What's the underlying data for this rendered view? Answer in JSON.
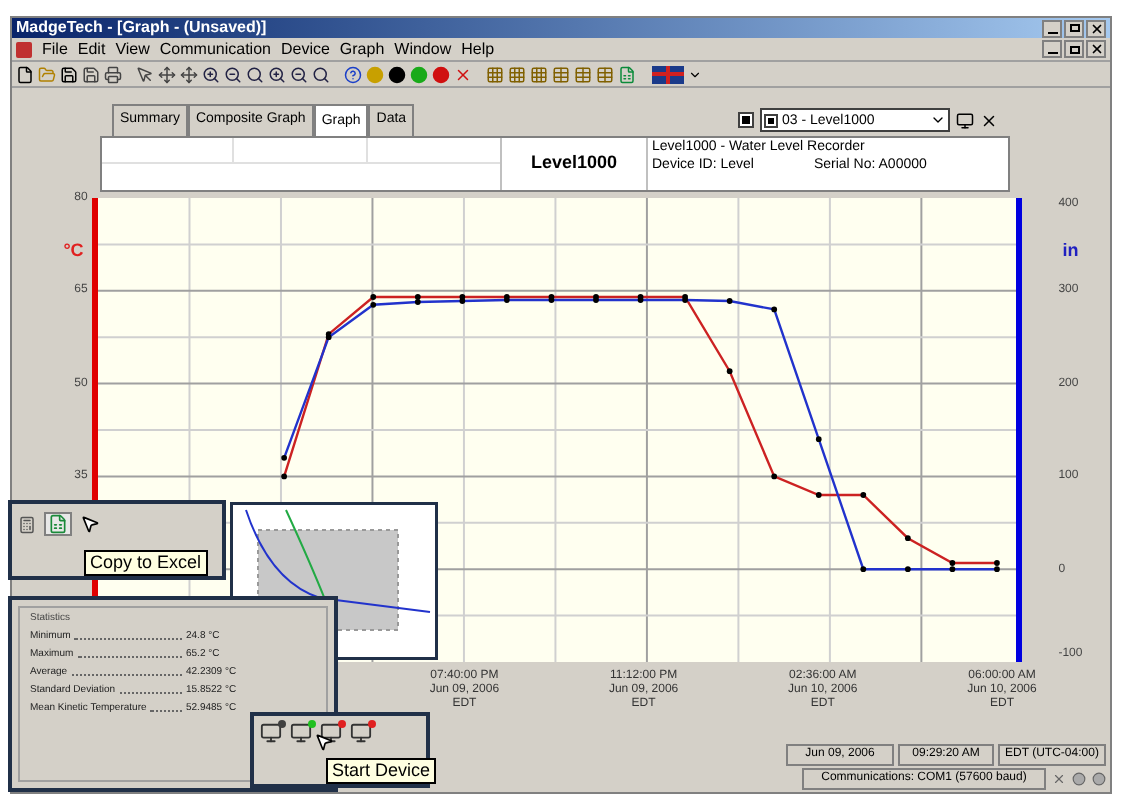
{
  "window": {
    "title": "MadgeTech - [Graph - (Unsaved)]"
  },
  "menu": [
    "File",
    "Edit",
    "View",
    "Communication",
    "Device",
    "Graph",
    "Window",
    "Help"
  ],
  "tabs": [
    {
      "label": "Summary",
      "selected": false
    },
    {
      "label": "Composite Graph",
      "selected": false
    },
    {
      "label": "Graph",
      "selected": true
    },
    {
      "label": "Data",
      "selected": false
    }
  ],
  "device_picker": {
    "show_checked": true,
    "checked": true,
    "value": "03 - Level1000"
  },
  "header": {
    "title": "Level1000",
    "lines": [
      "Level1000 - Water Level Recorder",
      "Device ID: Level",
      "Serial No: A00000"
    ]
  },
  "chart": {
    "chart_data": {
      "type": "line",
      "ylabel": "°C",
      "ylim": [
        5,
        80
      ],
      "yticks": [
        80,
        65,
        50,
        35
      ],
      "y2label": "in",
      "y2lim": [
        -100,
        400
      ],
      "y2ticks": [
        400,
        300,
        200,
        100,
        0,
        -100
      ],
      "grid": true,
      "categories": [
        null,
        null,
        null,
        null,
        null,
        null,
        null,
        null,
        "07:40:00 PM\nJun 09, 2006\nEDT",
        null,
        null,
        null,
        "11:12:00 PM\nJun 09, 2006\nEDT",
        null,
        null,
        null,
        "02:36:00 AM\nJun 10, 2006\nEDT",
        null,
        null,
        null,
        "06:00:00 AM\nJun 10, 2006\nEDT"
      ],
      "series": [
        {
          "color": "#cc2222",
          "values": [
            null,
            null,
            null,
            null,
            35,
            58,
            64,
            64,
            64,
            64,
            64,
            64,
            64,
            64,
            52,
            35,
            32,
            32,
            25,
            21,
            21
          ]
        },
        {
          "color": "#2233cc",
          "axis": "y2",
          "values": [
            null,
            null,
            null,
            null,
            120,
            250,
            285,
            288,
            289,
            290,
            290,
            290,
            290,
            290,
            289,
            280,
            140,
            0,
            0,
            0,
            0
          ]
        }
      ]
    }
  },
  "copy_panel": {
    "tooltip": "Copy to Excel"
  },
  "statistics": {
    "title": "Statistics",
    "rows": [
      {
        "label": "Minimum",
        "value": "24.8 °C"
      },
      {
        "label": "Maximum",
        "value": "65.2 °C"
      },
      {
        "label": "Average",
        "value": "42.2309 °C"
      },
      {
        "label": "Standard Deviation",
        "value": "15.8522 °C"
      },
      {
        "label": "Mean Kinetic Temperature",
        "value": "52.9485 °C"
      }
    ]
  },
  "device_panel": {
    "tooltip": "Start Device"
  },
  "status_bar": {
    "date": "Jun 09, 2006",
    "time": "09:29:20 AM",
    "zone": "EDT (UTC-04:00)",
    "communications": "Communications: COM1 (57600 baud)"
  }
}
